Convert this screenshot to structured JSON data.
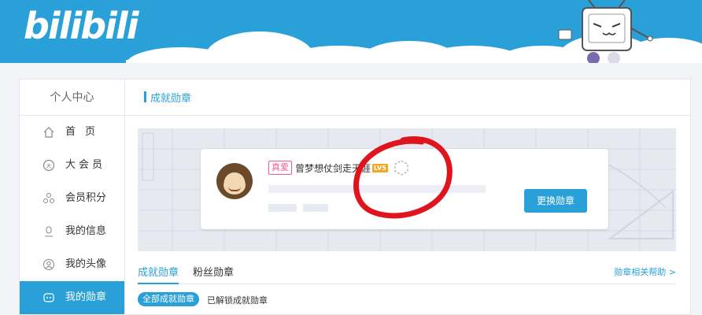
{
  "header": {
    "logo": "bilibili"
  },
  "sidebar": {
    "title": "个人中心",
    "items": [
      {
        "label": "首页",
        "icon": "home-icon",
        "active": false
      },
      {
        "label": "大会员",
        "icon": "vip-icon",
        "active": false
      },
      {
        "label": "会员积分",
        "icon": "points-icon",
        "active": false
      },
      {
        "label": "我的信息",
        "icon": "user-icon",
        "active": false
      },
      {
        "label": "我的头像",
        "icon": "avatar-icon",
        "active": false
      },
      {
        "label": "我的勋章",
        "icon": "medal-icon",
        "active": true
      }
    ]
  },
  "content": {
    "title": "成就勋章",
    "medal_card": {
      "tag": "真爱",
      "username": "曾梦想仗剑走天涯",
      "level": "LV5",
      "change_button": "更换勋章"
    },
    "tabs": [
      {
        "label": "成就勋章",
        "active": true
      },
      {
        "label": "粉丝勋章",
        "active": false
      }
    ],
    "help_link": "勋章相关帮助 >",
    "filters": {
      "all": "全部成就勋章",
      "unlocked": "已解锁成就勋章"
    }
  },
  "colors": {
    "accent": "#2aa0d8",
    "pink": "#f25d8e",
    "annotation_red": "#e0141e"
  }
}
